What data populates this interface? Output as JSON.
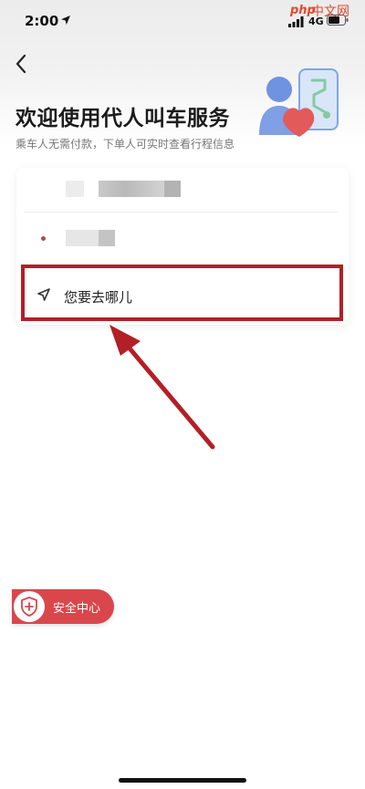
{
  "status_bar": {
    "time": "2:00",
    "network": "4G",
    "watermark_latin": "php",
    "watermark_cn": "中文网"
  },
  "header": {
    "title": "欢迎使用代人叫车服务",
    "subtitle": "乘车人无需付款，下单人可实时查看行程信息"
  },
  "form": {
    "destination_placeholder": "您要去哪儿"
  },
  "safety": {
    "label": "安全中心"
  },
  "colors": {
    "highlight_border": "#b31f26",
    "annotation_arrow": "#b31f26",
    "safety_bg": "#d9474d",
    "origin_dot": "#b24a4a"
  },
  "icons": {
    "back": "chevron-left-icon",
    "destination": "navigation-arrow-icon",
    "safety": "shield-plus-icon",
    "location": "location-arrow-icon"
  }
}
